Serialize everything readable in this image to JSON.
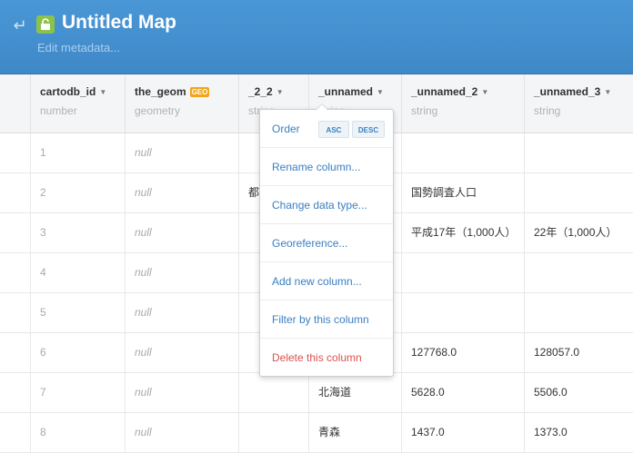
{
  "header": {
    "title": "Untitled Map",
    "edit_metadata": "Edit metadata...",
    "accent": "#4a97d6"
  },
  "columns": [
    {
      "name": "cartodb_id",
      "type": "number"
    },
    {
      "name": "the_geom",
      "type": "geometry",
      "badge": "GEO"
    },
    {
      "name": "_2_2",
      "type": "string"
    },
    {
      "name": "_unnamed",
      "type": "string"
    },
    {
      "name": "_unnamed_2",
      "type": "string"
    },
    {
      "name": "_unnamed_3",
      "type": "string"
    }
  ],
  "rows": [
    {
      "id": "1",
      "geom": "null",
      "c3": "",
      "c4": "",
      "c5": "",
      "c6": ""
    },
    {
      "id": "2",
      "geom": "null",
      "c3": "都",
      "c4": "",
      "c5": "国勢調査人口",
      "c6": ""
    },
    {
      "id": "3",
      "geom": "null",
      "c3": "",
      "c4": "",
      "c5": "平成17年（1,000人）",
      "c6": "22年（1,000人）"
    },
    {
      "id": "4",
      "geom": "null",
      "c3": "",
      "c4": "",
      "c5": "",
      "c6": ""
    },
    {
      "id": "5",
      "geom": "null",
      "c3": "",
      "c4": "",
      "c5": "",
      "c6": ""
    },
    {
      "id": "6",
      "geom": "null",
      "c3": "",
      "c4": "",
      "c5": "127768.0",
      "c6": "128057.0"
    },
    {
      "id": "7",
      "geom": "null",
      "c3": "",
      "c4": "北海道",
      "c5": "5628.0",
      "c6": "5506.0"
    },
    {
      "id": "8",
      "geom": "null",
      "c3": "",
      "c4": "青森",
      "c5": "1437.0",
      "c6": "1373.0"
    }
  ],
  "dropdown": {
    "order": "Order",
    "asc": "ASC",
    "desc": "DESC",
    "rename": "Rename column...",
    "change_type": "Change data type...",
    "georeference": "Georeference...",
    "add_column": "Add new column...",
    "filter": "Filter by this column",
    "delete": "Delete this column"
  }
}
